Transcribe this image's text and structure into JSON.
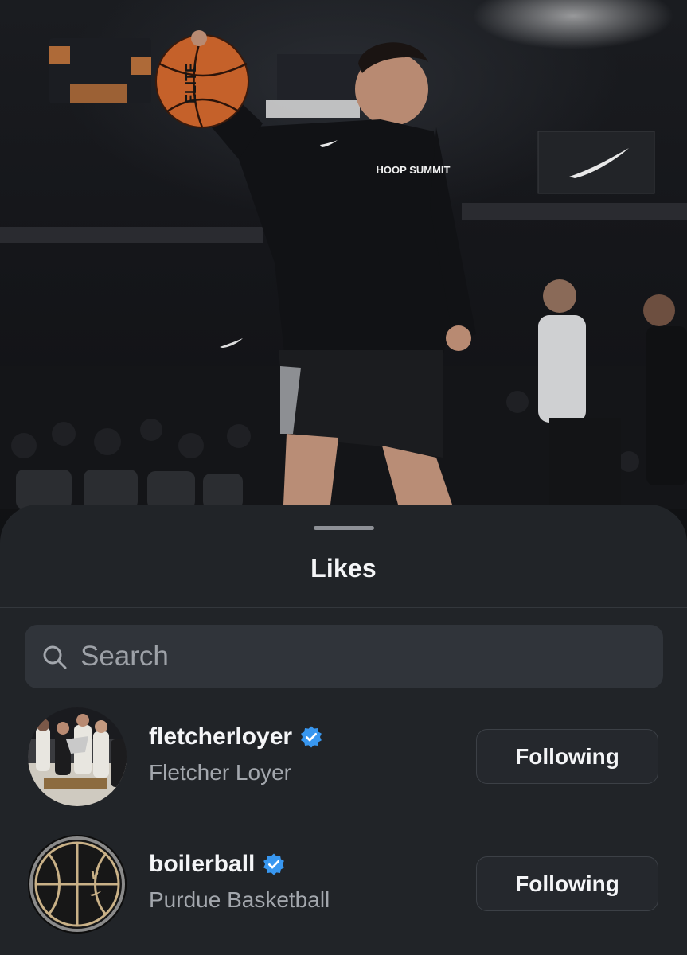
{
  "sheet": {
    "title": "Likes"
  },
  "search": {
    "placeholder": "Search"
  },
  "likes": [
    {
      "username": "fletcherloyer",
      "full_name": "Fletcher Loyer",
      "verified": true,
      "button_label": "Following",
      "avatar": "team-celebration-photo"
    },
    {
      "username": "boilerball",
      "full_name": "Purdue Basketball",
      "verified": true,
      "button_label": "Following",
      "avatar": "basketball-logo"
    }
  ],
  "photo": {
    "shirt_text": "HOOP SUMMIT",
    "ball_text": "ELITE"
  },
  "colors": {
    "sheet_bg": "#212428",
    "verified_blue": "#3897f0",
    "text_primary": "#f4f5f7",
    "text_secondary": "#a3a7ad"
  }
}
